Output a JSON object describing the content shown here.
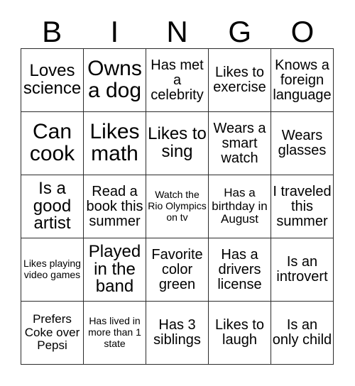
{
  "card": {
    "title_letters": [
      "B",
      "I",
      "N",
      "G",
      "O"
    ],
    "columns": 5,
    "rows": 5,
    "border_color": "#2b2b2b",
    "background_color": "#ffffff",
    "text_color": "#000000",
    "cells": [
      {
        "text": "Loves science",
        "size": "lg"
      },
      {
        "text": "Owns a dog",
        "size": "xl"
      },
      {
        "text": "Has met a celebrity",
        "size": "md"
      },
      {
        "text": "Likes to exercise",
        "size": "md"
      },
      {
        "text": "Knows a foreign language",
        "size": "md"
      },
      {
        "text": "Can cook",
        "size": "xl"
      },
      {
        "text": "Likes math",
        "size": "xl"
      },
      {
        "text": "Likes to sing",
        "size": "lg"
      },
      {
        "text": "Wears a smart watch",
        "size": "md"
      },
      {
        "text": "Wears glasses",
        "size": "md"
      },
      {
        "text": "Is a good artist",
        "size": "lg"
      },
      {
        "text": "Read a book this summer",
        "size": "md"
      },
      {
        "text": "Watch the Rio Olympics on tv",
        "size": "xs"
      },
      {
        "text": "Has a birthday in August",
        "size": "sm"
      },
      {
        "text": "I traveled this summer",
        "size": "md"
      },
      {
        "text": "Likes playing video games",
        "size": "xs"
      },
      {
        "text": "Played in the band",
        "size": "lg"
      },
      {
        "text": "Favorite color green",
        "size": "md"
      },
      {
        "text": "Has a drivers license",
        "size": "md"
      },
      {
        "text": "Is an introvert",
        "size": "md"
      },
      {
        "text": "Prefers Coke over Pepsi",
        "size": "sm"
      },
      {
        "text": "Has lived in more than 1 state",
        "size": "xs"
      },
      {
        "text": "Has 3 siblings",
        "size": "md"
      },
      {
        "text": "Likes to laugh",
        "size": "md"
      },
      {
        "text": "Is an only child",
        "size": "md"
      }
    ]
  }
}
